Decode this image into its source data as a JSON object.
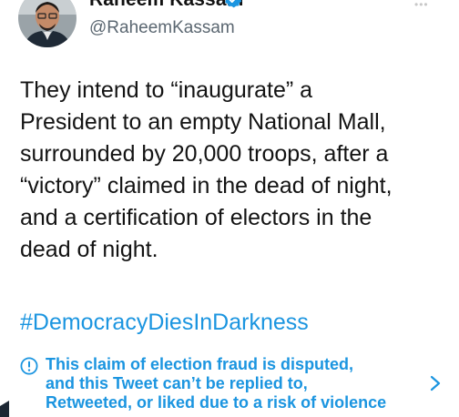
{
  "tweet": {
    "author": {
      "display_name": "Raheem Kassam",
      "handle": "@RaheemKassam",
      "verified_icon": "verified-badge-icon"
    },
    "body_lines": [
      "They intend to “inaugurate” a",
      "President to an empty National Mall,",
      "surrounded by 20,000 troops, after a",
      "“victory” claimed in the dead of night,",
      "and a certification of electors in the",
      "dead of night."
    ],
    "hashtag": "#DemocracyDiesInDarkness",
    "notice": {
      "icon": "exclamation-circle-icon",
      "lines": [
        "This claim of election fraud is disputed,",
        "and this Tweet can’t be replied to,",
        "Retweeted, or liked due to a risk of violence"
      ],
      "chevron": "chevron-right-icon"
    }
  },
  "colors": {
    "accent": "#1b95e0",
    "text": "#131313",
    "secondary": "#5b6771",
    "background": "#ffffff"
  }
}
